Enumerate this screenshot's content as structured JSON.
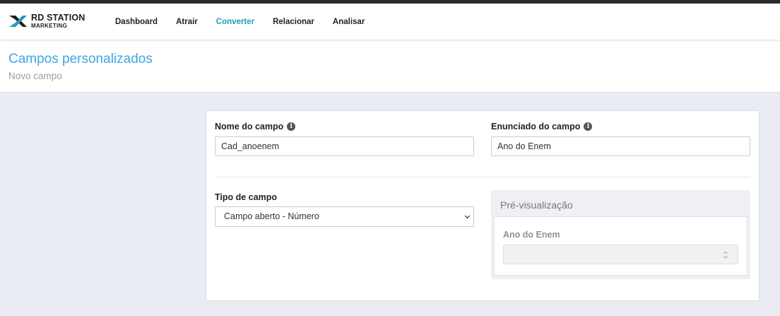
{
  "brand": {
    "line1": "RD STATION",
    "line2": "MARKETING",
    "accent_color": "#1aa0b8",
    "logo_icon": "rd-station-logo-icon"
  },
  "nav": {
    "items": [
      {
        "label": "Dashboard",
        "active": false
      },
      {
        "label": "Atrair",
        "active": false
      },
      {
        "label": "Converter",
        "active": true
      },
      {
        "label": "Relacionar",
        "active": false
      },
      {
        "label": "Analisar",
        "active": false
      }
    ]
  },
  "header": {
    "title": "Campos personalizados",
    "subtitle": "Novo campo",
    "title_color": "#3fa7e0"
  },
  "form": {
    "field_name": {
      "label": "Nome do campo",
      "value": "Cad_anoenem",
      "icon": "info-icon"
    },
    "field_statement": {
      "label": "Enunciado do campo",
      "value": "Ano do Enem",
      "icon": "info-icon"
    },
    "field_type": {
      "label": "Tipo de campo",
      "selected": "Campo aberto - Número",
      "icon": "chevron-down-icon"
    },
    "preview": {
      "title": "Pré-visualização",
      "field_label": "Ano do Enem",
      "input_value": "",
      "icon": "spinner-arrows-icon"
    }
  }
}
